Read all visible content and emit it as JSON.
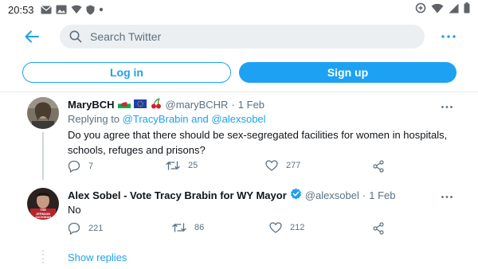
{
  "status_bar": {
    "time": "20:53"
  },
  "header": {
    "search_placeholder": "Search Twitter"
  },
  "auth": {
    "login_label": "Log in",
    "signup_label": "Sign up"
  },
  "tweets": [
    {
      "name": "MaryBCH",
      "handle": "@maryBCHR",
      "separator": "·",
      "date": "1 Feb",
      "replying_prefix": "Replying to",
      "replying_to_1": "@TracyBrabin",
      "replying_and": "and",
      "replying_to_2": "@alexsobel",
      "text": "Do you agree that there should be sex-segregated facilities for women in hospitals, schools, refuges and prisons?",
      "replies": "7",
      "retweets": "25",
      "likes": "277"
    },
    {
      "name": "Alex Sobel - Vote Tracy Brabin for WY Mayor",
      "handle": "@alexsobel",
      "separator": "·",
      "date": "1 Feb",
      "text": "No",
      "replies": "221",
      "retweets": "86",
      "likes": "212",
      "avatar_text_1": "THE",
      "avatar_text_2": "JERMAIN",
      "avatar_text_3": "JACKMAN"
    }
  ],
  "show_replies_label": "Show replies",
  "colors": {
    "accent": "#1da1f2",
    "muted": "#5b7083",
    "text": "#0f1419",
    "search_bg": "#eceff1"
  }
}
